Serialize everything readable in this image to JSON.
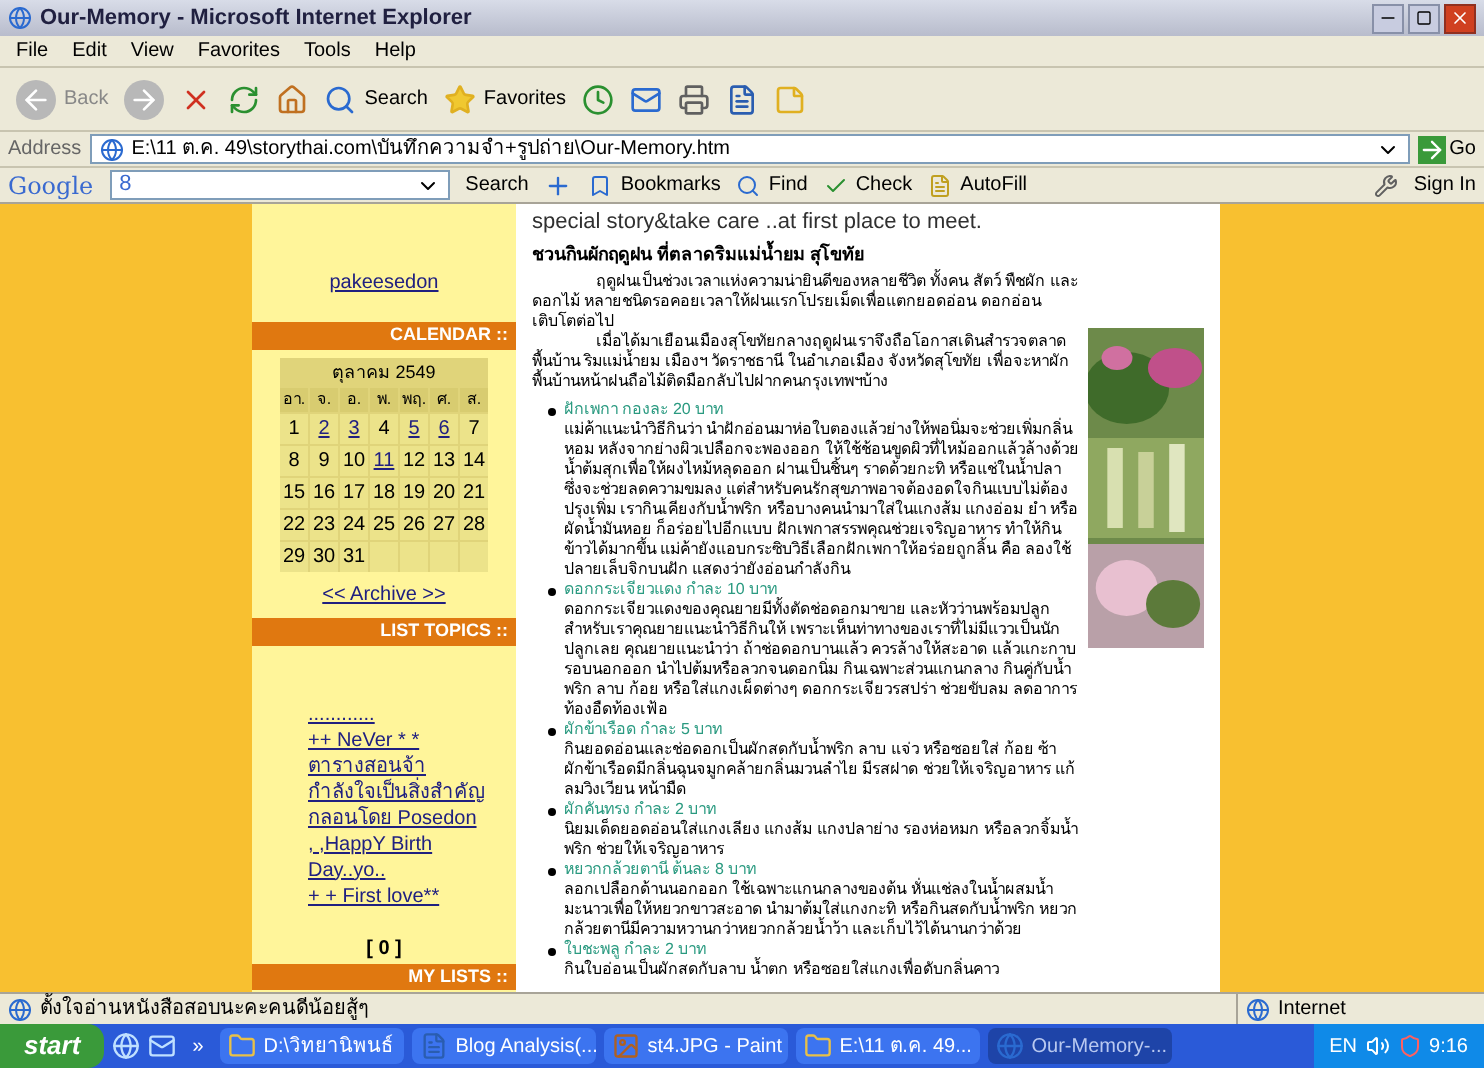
{
  "window": {
    "title": "Our-Memory - Microsoft Internet Explorer"
  },
  "menu": [
    "File",
    "Edit",
    "View",
    "Favorites",
    "Tools",
    "Help"
  ],
  "toolbar": {
    "back": "Back",
    "search": "Search",
    "favorites": "Favorites"
  },
  "address": {
    "label": "Address",
    "value": "E:\\11 ต.ค. 49\\storythai.com\\บันทึกความจำ+รูปถ่าย\\Our-Memory.htm",
    "go": "Go"
  },
  "google_bar": {
    "logo": "Google",
    "query": "8",
    "search": "Search",
    "bookmarks": "Bookmarks",
    "find": "Find",
    "check": "Check",
    "autofill": "AutoFill",
    "sign_in": "Sign In"
  },
  "sidebar": {
    "user": "pakeesedon",
    "calendar_header": "CALENDAR ::",
    "month": "ตุลาคม 2549",
    "weekdays": [
      "อา.",
      "จ.",
      "อ.",
      "พ.",
      "พฤ.",
      "ศ.",
      "ส."
    ],
    "days": [
      {
        "label": "1",
        "link": false
      },
      {
        "label": "2",
        "link": true
      },
      {
        "label": "3",
        "link": true
      },
      {
        "label": "4",
        "link": false
      },
      {
        "label": "5",
        "link": true
      },
      {
        "label": "6",
        "link": true
      },
      {
        "label": "7",
        "link": false
      },
      {
        "label": "8",
        "link": false
      },
      {
        "label": "9",
        "link": false
      },
      {
        "label": "10",
        "link": false
      },
      {
        "label": "11",
        "link": true
      },
      {
        "label": "12",
        "link": false
      },
      {
        "label": "13",
        "link": false
      },
      {
        "label": "14",
        "link": false
      },
      {
        "label": "15",
        "link": false
      },
      {
        "label": "16",
        "link": false
      },
      {
        "label": "17",
        "link": false
      },
      {
        "label": "18",
        "link": false
      },
      {
        "label": "19",
        "link": false
      },
      {
        "label": "20",
        "link": false
      },
      {
        "label": "21",
        "link": false
      },
      {
        "label": "22",
        "link": false
      },
      {
        "label": "23",
        "link": false
      },
      {
        "label": "24",
        "link": false
      },
      {
        "label": "25",
        "link": false
      },
      {
        "label": "26",
        "link": false
      },
      {
        "label": "27",
        "link": false
      },
      {
        "label": "28",
        "link": false
      },
      {
        "label": "29",
        "link": false
      },
      {
        "label": "30",
        "link": false
      },
      {
        "label": "31",
        "link": false
      }
    ],
    "archive": "<< Archive >>",
    "topics_header": "LIST TOPICS ::",
    "topics": [
      "............",
      "++ NeVer * *",
      "ตารางสอนจ้า",
      "กำลังใจเป็นสิ่งสำคัญ",
      "กลอนโดย Posedon",
      ", ,HappY Birth Day..yo..",
      "+ + First love**"
    ],
    "counter": "[ 0 ]",
    "lists_header": "MY LISTS ::"
  },
  "post": {
    "intro": "special story&take care ..at first place to meet.",
    "title": "ชวนกินผักฤดูฝน ที่ตลาดริมแม่น้ำยม สุโขทัย",
    "paragraphs": [
      "ฤดูฝนเป็นช่วงเวลาแห่งความน่ายินดีของหลายชีวิต ทั้งคน สัตว์ พืชผัก และดอกไม้ หลายชนิดรอคอยเวลาให้ฝนแรกโปรยเม็ดเพื่อแตกยอดอ่อน ดอกอ่อน เติบโตต่อไป",
      "เมื่อได้มาเยือนเมืองสุโขทัยกลางฤดูฝนเราจึงถือโอกาสเดินสำรวจตลาดพื้นบ้าน ริมแม่น้ำยม เมืองฯ วัดราชธานี ในอำเภอเมือง จังหวัดสุโขทัย เพื่อจะหาผักพื้นบ้านหน้าฝนถือไม้ติดมือกลับไปฝากคนกรุงเทพฯบ้าง"
    ],
    "items": [
      {
        "name": "ฝักเพกา กองละ 20 บาท",
        "text": "แม่ค้าแนะนำวิธีกินว่า นำฝักอ่อนมาห่อใบตองแล้วย่างให้พอนิ่มจะช่วยเพิ่มกลิ่นหอม หลังจากย่างผิวเปลือกจะพองออก ให้ใช้ช้อนขูดผิวที่ไหม้ออกแล้วล้างด้วยน้ำต้มสุกเพื่อให้ผงไหม้หลุดออก ฝานเป็นชิ้นๆ ราดด้วยกะทิ หรือแช่ในน้ำปลา ซึ่งจะช่วยลดความขมลง แต่สำหรับคนรักสุขภาพอาจต้องอดใจกินแบบไม่ต้องปรุงเพิ่ม เรากินเคียงกับน้ำพริก หรือบางคนนำมาใส่ในแกงส้ม แกงอ่อม ยำ หรือผัดน้ำมันหอย ก็อร่อยไปอีกแบบ ฝักเพกาสรรพคุณช่วยเจริญอาหาร ทำให้กินข้าวได้มากขึ้น แม่ค้ายังแอบกระซิบวิธีเลือกฝักเพกาให้อร่อยถูกลิ้น คือ ลองใช้ปลายเล็บจิกบนฝัก แสดงว่ายังอ่อนกำลังกิน"
      },
      {
        "name": "ดอกกระเจียวแดง กำละ 10 บาท",
        "text": "ดอกกระเจียวแดงของคุณยายมีทั้งตัดช่อดอกมาขาย และหัวว่านพร้อมปลูกสำหรับเราคุณยายแนะนำวิธีกินให้ เพราะเห็นท่าทางของเราที่ไม่มีแววเป็นนักปลูกเลย คุณยายแนะนำว่า ถ้าช่อดอกบานแล้ว ควรล้างให้สะอาด แล้วแกะกาบรอบนอกออก นำไปต้มหรือลวกจนดอกนิ่ม กินเฉพาะส่วนแกนกลาง กินคู่กับน้ำพริก ลาบ ก้อย หรือใส่แกงเผ็ดต่างๆ ดอกกระเจียวรสปร่า ช่วยขับลม ลดอาการท้องอืดท้องเฟ้อ"
      },
      {
        "name": "ผักข้าเรือด กำละ 5 บาท",
        "text": "กินยอดอ่อนและช่อดอกเป็นผักสดกับน้ำพริก ลาบ แจ่ว หรือซอยใส่ ก้อย ซ้า ผักข้าเรือดมีกลิ่นฉุนจมูกคล้ายกลิ่นมวนลำไย มีรสฝาด ช่วยให้เจริญอาหาร แก้ลมวิงเวียน หน้ามืด"
      },
      {
        "name": "ผักคันทรง กำละ 2 บาท",
        "text": "นิยมเด็ดยอดอ่อนใส่แกงเลียง แกงส้ม แกงปลาย่าง รองห่อหมก หรือลวกจิ้มน้ำพริก ช่วยให้เจริญอาหาร"
      },
      {
        "name": "หยวกกล้วยตานี ต้นละ 8 บาท",
        "text": "ลอกเปลือกด้านนอกออก ใช้เฉพาะแกนกลางของต้น หั่นแช่ลงในน้ำผสมน้ำมะนาวเพื่อให้หยวกขาวสะอาด นำมาต้มใส่แกงกะทิ หรือกินสดกับน้ำพริก หยวกกล้วยตานีมีความหวานกว่าหยวกกล้วยน้ำว้า และเก็บไว้ได้นานกว่าด้วย"
      },
      {
        "name": "ใบชะพลู กำละ 2 บาท",
        "text": "กินใบอ่อนเป็นผักสดกับลาบ น้ำตก หรือซอยใส่แกงเพื่อดับกลิ่นคาว"
      }
    ]
  },
  "status_bar": {
    "text": "ตั้งใจอ่านหนังสือสอบนะคะคนดีน้อยสู้ๆ",
    "zone": "Internet"
  },
  "taskbar": {
    "start": "start",
    "more": "»",
    "tasks": [
      {
        "label": "D:\\วิทยานิพนธ์",
        "selected": false,
        "kind": "folder"
      },
      {
        "label": "Blog Analysis(...",
        "selected": false,
        "kind": "document"
      },
      {
        "label": "st4.JPG - Paint",
        "selected": false,
        "kind": "paint"
      },
      {
        "label": "E:\\11 ต.ค. 49...",
        "selected": false,
        "kind": "folder"
      },
      {
        "label": "Our-Memory-...",
        "selected": true,
        "kind": "browser"
      }
    ],
    "language": "EN",
    "clock": "9:16"
  }
}
